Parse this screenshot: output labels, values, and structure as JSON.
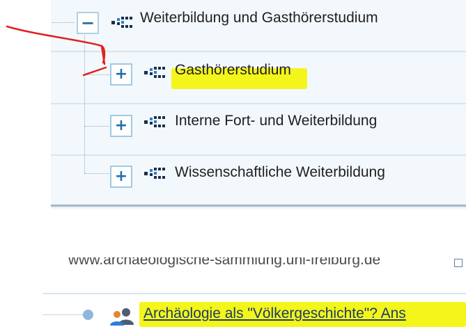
{
  "tree": {
    "root": {
      "label": "Weiterbildung und Gasthörerstudium",
      "expander_glyph": "−",
      "expander_icon": "collapse-icon",
      "icon": "org-unit-icon"
    },
    "children": [
      {
        "label": "Gasthörerstudium",
        "expander_glyph": "+",
        "expander_icon": "expand-icon",
        "icon": "org-unit-icon",
        "highlighted": true
      },
      {
        "label": "Interne Fort- und Weiterbildung",
        "expander_glyph": "+",
        "expander_icon": "expand-icon",
        "icon": "org-unit-icon",
        "highlighted": false
      },
      {
        "label": "Wissenschaftliche Weiterbildung",
        "expander_glyph": "+",
        "expander_icon": "expand-icon",
        "icon": "org-unit-icon",
        "highlighted": false
      }
    ]
  },
  "cutoff_link": {
    "text": "www.archaeologische-sammlung.uni-freiburg.de",
    "icon": "external-link-icon"
  },
  "person_entry": {
    "bullet_icon": "bullet-dot-icon",
    "icon": "people-icon",
    "link_text": "Archäologie als \"Völkergeschichte\"? Ans",
    "highlighted": true
  },
  "annotation": {
    "icon": "red-arrow-annotation",
    "color": "#e02020"
  },
  "colors": {
    "highlight": "#f3f51b",
    "panel_background": "#f3f8fc",
    "row_divider": "#d9e5ef",
    "expander_border": "#9fc9e4",
    "expander_glyph": "#1f6fae",
    "icon_dark": "#1b2e4d",
    "icon_blue": "#2f7fd1",
    "link": "#1d3d66"
  }
}
